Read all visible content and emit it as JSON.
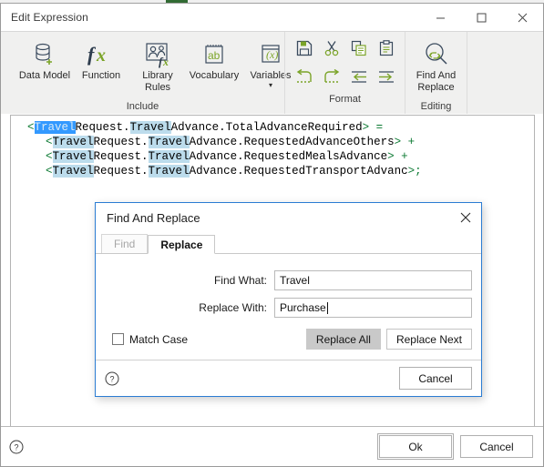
{
  "window": {
    "title": "Edit Expression",
    "minimize_label": "minimize-icon",
    "maximize_label": "maximize-icon",
    "close_label": "close-icon"
  },
  "ribbon": {
    "groups": [
      {
        "label": "Include",
        "items": [
          {
            "label": "Data Model",
            "icon": "database-plus-icon"
          },
          {
            "label": "Function",
            "icon": "fx-icon"
          },
          {
            "label": "Library Rules",
            "icon": "library-rules-icon"
          },
          {
            "label": "Vocabulary",
            "icon": "vocabulary-ab-icon"
          },
          {
            "label": "Variables",
            "icon": "variables-x-icon",
            "caret": "▾"
          }
        ]
      },
      {
        "label": "Format",
        "items": [
          {
            "label": "Save",
            "icon": "save-icon"
          },
          {
            "label": "Cut",
            "icon": "cut-icon"
          },
          {
            "label": "Copy",
            "icon": "copy-icon"
          },
          {
            "label": "Paste",
            "icon": "paste-icon"
          },
          {
            "label": "Undo",
            "icon": "undo-icon"
          },
          {
            "label": "Redo",
            "icon": "redo-icon"
          },
          {
            "label": "Outdent",
            "icon": "outdent-icon"
          },
          {
            "label": "Indent",
            "icon": "indent-icon"
          }
        ]
      },
      {
        "label": "Editing",
        "items": [
          {
            "label": "Find And Replace",
            "icon": "find-replace-icon"
          }
        ]
      }
    ]
  },
  "editor": {
    "lines": [
      {
        "indent": 0,
        "parts": [
          {
            "t": "<",
            "k": "op"
          },
          {
            "t": "Travel",
            "k": "sel"
          },
          {
            "t": "Request.",
            "k": "plain"
          },
          {
            "t": "Travel",
            "k": "hl"
          },
          {
            "t": "Advance.TotalAdvanceRequired",
            "k": "plain"
          },
          {
            "t": "> =",
            "k": "op"
          }
        ]
      },
      {
        "indent": 1,
        "parts": [
          {
            "t": "<",
            "k": "op"
          },
          {
            "t": "Travel",
            "k": "hl"
          },
          {
            "t": "Request.",
            "k": "plain"
          },
          {
            "t": "Travel",
            "k": "hl"
          },
          {
            "t": "Advance.RequestedAdvanceOthers",
            "k": "plain"
          },
          {
            "t": "> +",
            "k": "op"
          }
        ]
      },
      {
        "indent": 1,
        "parts": [
          {
            "t": "<",
            "k": "op"
          },
          {
            "t": "Travel",
            "k": "hl"
          },
          {
            "t": "Request.",
            "k": "plain"
          },
          {
            "t": "Travel",
            "k": "hl"
          },
          {
            "t": "Advance.RequestedMealsAdvance",
            "k": "plain"
          },
          {
            "t": "> +",
            "k": "op"
          }
        ]
      },
      {
        "indent": 1,
        "parts": [
          {
            "t": "<",
            "k": "op"
          },
          {
            "t": "Travel",
            "k": "hl"
          },
          {
            "t": "Request.",
            "k": "plain"
          },
          {
            "t": "Travel",
            "k": "hl"
          },
          {
            "t": "Advance.RequestedTransportAdvanc",
            "k": "plain"
          },
          {
            "t": ">;",
            "k": "op"
          }
        ]
      }
    ]
  },
  "bottom_bar": {
    "help_icon": "help-icon",
    "ok_label": "Ok",
    "cancel_label": "Cancel"
  },
  "dialog": {
    "title": "Find And Replace",
    "close_label": "close-icon",
    "tabs": [
      {
        "label": "Find",
        "active": false
      },
      {
        "label": "Replace",
        "active": true
      }
    ],
    "find_what_label": "Find What:",
    "find_what_value": "Travel",
    "replace_with_label": "Replace With:",
    "replace_with_value": "Purchase",
    "match_case_label": "Match Case",
    "match_case_checked": false,
    "replace_all_label": "Replace All",
    "replace_next_label": "Replace Next",
    "help_icon": "help-icon",
    "cancel_label": "Cancel"
  },
  "colors": {
    "accent": "#2b7cd3",
    "ribbon_bg": "#f0f0ef",
    "code_operator": "#0c7a33",
    "match_highlight": "#bcdcec",
    "selection": "#3399ff",
    "icon_dark": "#3b4b5e",
    "icon_green": "#7ba428"
  }
}
